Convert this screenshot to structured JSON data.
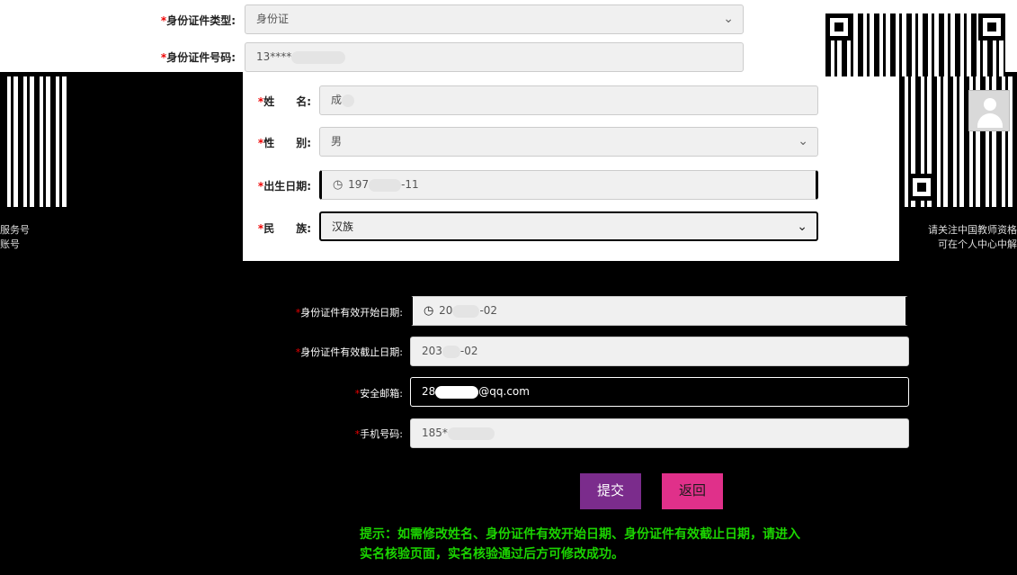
{
  "top_form": {
    "id_type_label": "身份证件类型:",
    "id_type_value": "身份证",
    "id_number_label": "身份证件号码:",
    "id_number_value": "13****"
  },
  "middle_form": {
    "name_label": "姓　　名:",
    "name_value": "成",
    "gender_label": "性　　别:",
    "gender_value": "男",
    "birth_label": "出生日期:",
    "birth_value_prefix": "197",
    "birth_value_suffix": "-11",
    "ethnicity_label": "民　　族:",
    "ethnicity_value": "汉族"
  },
  "lower_form": {
    "valid_start_label": "身份证件有效开始日期:",
    "valid_start_prefix": "20",
    "valid_start_suffix": "-02",
    "valid_end_label": "身份证件有效截止日期:",
    "valid_end_prefix": "203",
    "valid_end_suffix": "-02",
    "email_label": "安全邮箱:",
    "email_prefix": "28",
    "email_suffix": "@qq.com",
    "phone_label": "手机号码:",
    "phone_value": "185*"
  },
  "side": {
    "left_line1": "服务号",
    "left_line2": "账号",
    "right_line1": "请关注中国教师资格",
    "right_line2": "可在个人中心中解"
  },
  "buttons": {
    "submit": "提交",
    "back": "返回"
  },
  "tip": {
    "line1": "提示：如需修改姓名、身份证件有效开始日期、身份证件有效截止日期，请进入",
    "line2": "实名核验页面，实名核验通过后方可修改成功。"
  },
  "required_mark": "*",
  "chevron": "⌄",
  "colors": {
    "required": "#e00000",
    "submit_bg": "#7b2c8c",
    "back_bg": "#e0308a",
    "tip_text": "#1bd400"
  }
}
